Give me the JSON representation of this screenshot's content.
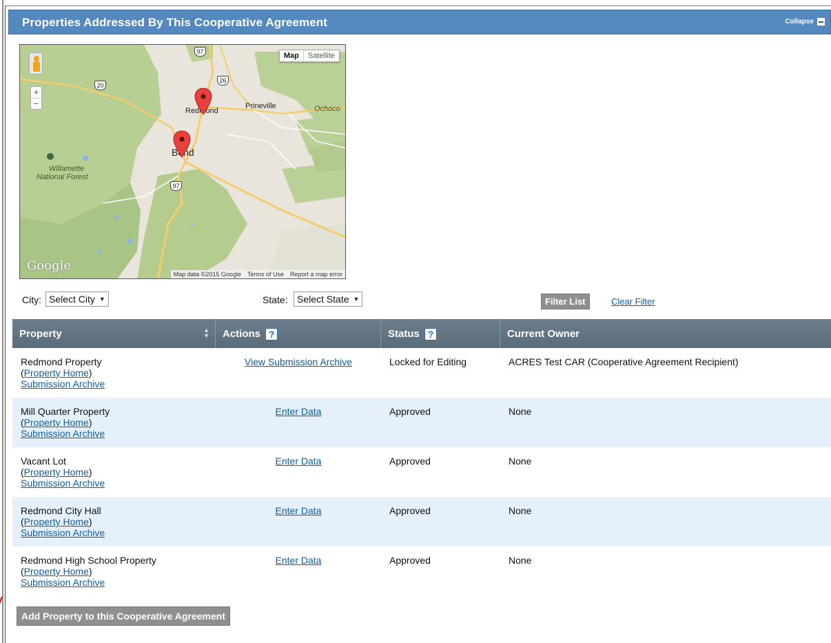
{
  "panel": {
    "title": "Properties Addressed By This Cooperative Agreement",
    "collapse_label": "Collapse"
  },
  "map": {
    "type_buttons": [
      "Map",
      "Satellite"
    ],
    "labels": {
      "redmond": "Redmond",
      "prineville": "Prineville",
      "ochoco": "Ochoco",
      "bend": "Bend",
      "willamette": "Willamette",
      "national_forest": "National Forest"
    },
    "highways": [
      "97",
      "26",
      "20",
      "97"
    ],
    "footer": [
      "Map data ©2015 Google",
      "Terms of Use",
      "Report a map error"
    ],
    "logo": "Google",
    "zoom_in": "+",
    "zoom_out": "−"
  },
  "filters": {
    "city_label": "City:",
    "city_value": "Select City",
    "state_label": "State:",
    "state_value": "Select State",
    "filter_button": "Filter List",
    "clear_link": "Clear Filter"
  },
  "table": {
    "headers": [
      "Property",
      "Actions",
      "Status",
      "Current Owner"
    ],
    "help_glyph": "?",
    "rows": [
      {
        "name": "Redmond Property",
        "home_link": "Property Home",
        "archive_link": "Submission Archive",
        "action": "View Submission Archive",
        "status": "Locked for Editing",
        "owner": "ACRES Test CAR (Cooperative Agreement Recipient)"
      },
      {
        "name": "Mill Quarter Property",
        "home_link": "Property Home",
        "archive_link": "Submission Archive",
        "action": "Enter Data",
        "status": "Approved",
        "owner": "None"
      },
      {
        "name": "Vacant Lot",
        "home_link": "Property Home",
        "archive_link": "Submission Archive",
        "action": "Enter Data",
        "status": "Approved",
        "owner": "None"
      },
      {
        "name": "Redmond City Hall",
        "home_link": "Property Home",
        "archive_link": "Submission Archive",
        "action": "Enter Data",
        "status": "Approved",
        "owner": "None"
      },
      {
        "name": "Redmond High School Property",
        "home_link": "Property Home",
        "archive_link": "Submission Archive",
        "action": "Enter Data",
        "status": "Approved",
        "owner": "None"
      }
    ]
  },
  "add_button": "Add Property to this Cooperative Agreement"
}
